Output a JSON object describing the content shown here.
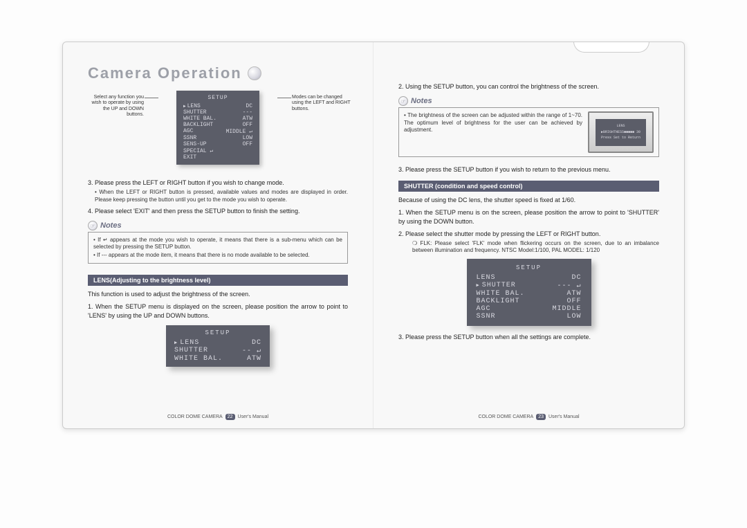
{
  "heading": "Camera Operation",
  "left": {
    "labels": {
      "select_side": "Select any function you wish to operate by using the UP and DOWN buttons.",
      "modes_side": "Modes can be changed using the LEFT and RIGHT buttons."
    },
    "osd_top": {
      "title": "SETUP",
      "rows": [
        {
          "label": "LENS",
          "value": "DC",
          "arrow": true
        },
        {
          "label": "SHUTTER",
          "value": "---"
        },
        {
          "label": "WHITE BAL.",
          "value": "ATW"
        },
        {
          "label": "BACKLIGHT",
          "value": "OFF"
        },
        {
          "label": "AGC",
          "value": "MIDDLE ↵"
        },
        {
          "label": "SSNR",
          "value": "LOW"
        },
        {
          "label": "SENS-UP",
          "value": "OFF"
        },
        {
          "label": "SPECIAL ↵",
          "value": ""
        },
        {
          "label": "EXIT",
          "value": ""
        }
      ]
    },
    "item3": "3. Please press the LEFT or RIGHT button if you wish to change mode.",
    "item3_bullet": "When the LEFT or RIGHT button is pressed, available values and modes are displayed in order. Please keep pressing the button until you get to the mode you wish to operate.",
    "item4": "4. Please select 'EXIT' and then press the SETUP button to finish the setting.",
    "notes_label": "Notes",
    "notes_lines": [
      "If ↵ appears at the mode you wish to operate, it means that there is a sub-menu which can be selected by pressing the SETUP button.",
      "If --- appears at the mode item, it means that there is no mode available to be selected."
    ],
    "section_lens": "LENS(Adjusting to the brightness level)",
    "lens_intro": "This function is used to adjust the brightness of the screen.",
    "lens_step1": "1. When the SETUP menu is displayed on the screen, please position the arrow to point to 'LENS' by using the UP and DOWN buttons.",
    "osd_lens": {
      "title": "SETUP",
      "rows": [
        {
          "label": "LENS",
          "value": "DC",
          "arrow": true
        },
        {
          "label": "SHUTTER",
          "value": "-- ↵"
        },
        {
          "label": "WHITE BAL.",
          "value": "ATW"
        }
      ]
    },
    "footer_product": "COLOR DOME CAMERA",
    "footer_page": "22",
    "footer_manual": "User's Manual"
  },
  "right": {
    "item2": "2. Using the SETUP button, you can control the brightness of the screen.",
    "notes_label": "Notes",
    "notes_text": "The brightness of the screen can be adjusted within the range of 1~70. The optimum level of brightness for the user can be achieved by adjustment.",
    "mini_lcd": {
      "title": "LENS",
      "line": "▶BRIGHTNESS■■■■■ 30",
      "foot": "Press Set to Return"
    },
    "item3": "3. Please press the SETUP button if you wish to return to the previous menu.",
    "section_shutter": "SHUTTER (condition and speed control)",
    "shutter_intro": "Because of using the DC lens, the shutter speed is fixed at 1/60.",
    "shutter_step1": "1. When the SETUP menu is on the screen, please position the arrow to point to 'SHUTTER' by using the DOWN button.",
    "shutter_step2": "2. Please select the shutter mode by pressing the LEFT or RIGHT button.",
    "flk_line": "❍ FLK: Please select 'FLK' mode when flickering occurs on the screen, due to an imbalance between illumination and frequency. NTSC Model:1/100, PAL MODEL: 1/120",
    "osd_shutter": {
      "title": "SETUP",
      "rows": [
        {
          "label": "LENS",
          "value": "DC"
        },
        {
          "label": "SHUTTER",
          "value": "--- ↵",
          "arrow": true
        },
        {
          "label": "WHITE BAL.",
          "value": "ATW"
        },
        {
          "label": "BACKLIGHT",
          "value": "OFF"
        },
        {
          "label": "AGC",
          "value": "MIDDLE"
        },
        {
          "label": "SSNR",
          "value": "LOW"
        }
      ]
    },
    "item_final": "3. Please press the SETUP button when all the settings are complete.",
    "footer_product": "COLOR DOME CAMERA",
    "footer_page": "23",
    "footer_manual": "User's Manual"
  }
}
